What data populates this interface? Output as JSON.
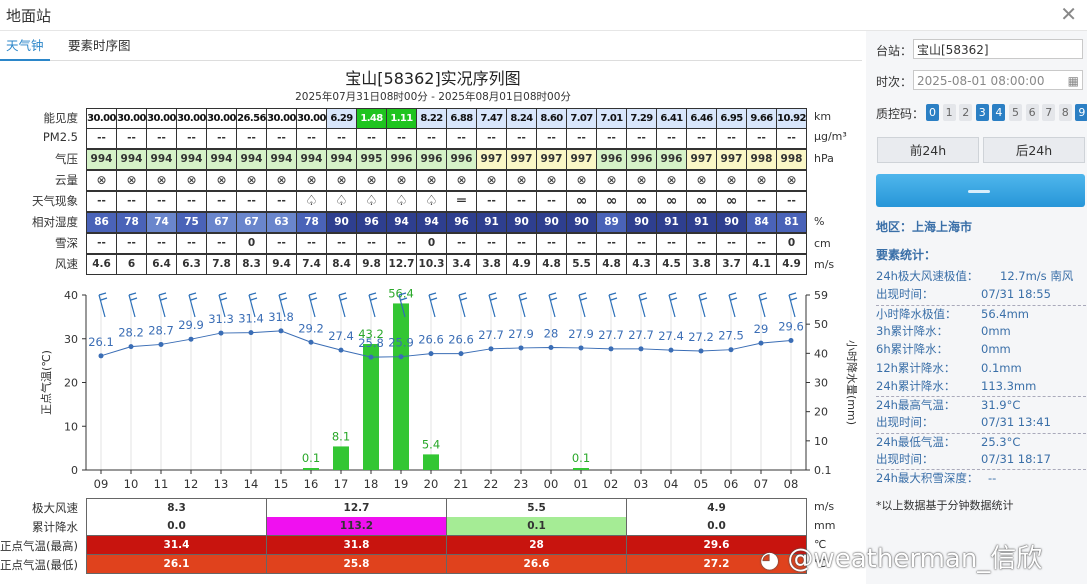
{
  "window": {
    "title": "地面站"
  },
  "tabs": [
    {
      "label": "天气钟"
    },
    {
      "label": "要素时序图"
    }
  ],
  "chart": {
    "title": "宝山[58362]实况序列图",
    "subtitle": "2025年07月31日08时00分 - 2025年08月01日08时00分"
  },
  "rows": {
    "visibility": {
      "label": "能见度",
      "unit": "km",
      "values": [
        "30.00",
        "30.00",
        "30.00",
        "30.00",
        "30.00",
        "26.56",
        "30.00",
        "30.00",
        "6.29",
        "1.48",
        "1.11",
        "8.22",
        "6.88",
        "7.47",
        "8.24",
        "8.60",
        "7.07",
        "7.01",
        "7.29",
        "6.41",
        "6.46",
        "6.95",
        "9.66",
        "10.92"
      ]
    },
    "pm25": {
      "label": "PM2.5",
      "unit": "μg/m³",
      "values": [
        "--",
        "--",
        "--",
        "--",
        "--",
        "--",
        "--",
        "--",
        "--",
        "--",
        "--",
        "--",
        "--",
        "--",
        "--",
        "--",
        "--",
        "--",
        "--",
        "--",
        "--",
        "--",
        "--",
        "--"
      ]
    },
    "pressure": {
      "label": "气压",
      "unit": "hPa",
      "values": [
        "994",
        "994",
        "994",
        "994",
        "994",
        "994",
        "994",
        "994",
        "994",
        "995",
        "996",
        "996",
        "996",
        "997",
        "997",
        "997",
        "997",
        "996",
        "996",
        "996",
        "997",
        "997",
        "998",
        "998"
      ]
    },
    "cloud": {
      "label": "云量",
      "symbol": "⊗",
      "count": 24
    },
    "weather": {
      "label": "天气现象",
      "codes": [
        "--",
        "--",
        "--",
        "--",
        "--",
        "--",
        "--",
        "rain",
        "rain",
        "rain",
        "rain",
        "rain",
        "fog",
        "--",
        "--",
        "--",
        "haze",
        "haze",
        "haze",
        "haze",
        "haze",
        "haze",
        "--",
        "--"
      ]
    },
    "humidity": {
      "label": "相对湿度",
      "unit": "%",
      "values": [
        "86",
        "78",
        "74",
        "75",
        "67",
        "67",
        "63",
        "78",
        "90",
        "96",
        "94",
        "94",
        "96",
        "91",
        "90",
        "90",
        "90",
        "89",
        "90",
        "91",
        "91",
        "90",
        "84",
        "81"
      ]
    },
    "snow": {
      "label": "雪深",
      "unit": "cm",
      "values": [
        "--",
        "--",
        "--",
        "--",
        "--",
        "0",
        "--",
        "--",
        "--",
        "--",
        "--",
        "0",
        "--",
        "--",
        "--",
        "--",
        "--",
        "--",
        "--",
        "--",
        "--",
        "--",
        "--",
        "0"
      ]
    },
    "wind": {
      "label": "风速",
      "unit": "m/s",
      "values": [
        "4.6",
        "6",
        "6.4",
        "6.3",
        "7.8",
        "8.3",
        "9.4",
        "7.4",
        "8.4",
        "9.8",
        "12.7",
        "10.3",
        "3.4",
        "3.8",
        "4.9",
        "4.8",
        "5.5",
        "4.8",
        "4.3",
        "4.5",
        "3.8",
        "3.7",
        "4.1",
        "4.9"
      ]
    }
  },
  "chart_data": {
    "type": "bar+line",
    "x": [
      "09",
      "10",
      "11",
      "12",
      "13",
      "14",
      "15",
      "16",
      "17",
      "18",
      "19",
      "20",
      "21",
      "22",
      "23",
      "00",
      "01",
      "02",
      "03",
      "04",
      "05",
      "06",
      "07",
      "08"
    ],
    "ylabel_left": "正点气温(℃)",
    "ylabel_right": "小时降水量(mm)",
    "ylim_left": [
      0,
      40
    ],
    "left_ticks": [
      0,
      10,
      20,
      30,
      40
    ],
    "right_ticks": [
      "59",
      "50",
      "40",
      "30",
      "20",
      "10",
      "0.1"
    ],
    "temperature": [
      26.1,
      28.2,
      28.7,
      29.9,
      31.3,
      31.4,
      31.8,
      29.2,
      27.4,
      25.8,
      25.9,
      26.6,
      26.6,
      27.7,
      27.9,
      28,
      27.9,
      27.7,
      27.7,
      27.4,
      27.2,
      27.5,
      29,
      29.6
    ],
    "precipitation": [
      null,
      null,
      null,
      null,
      null,
      null,
      null,
      0.1,
      8.1,
      43.2,
      56.4,
      5.4,
      null,
      null,
      null,
      null,
      0.1,
      null,
      null,
      null,
      null,
      null,
      null,
      null
    ]
  },
  "bottom": {
    "maxwind": {
      "label": "极大风速",
      "unit": "m/s",
      "values": [
        "8.3",
        "12.7",
        "5.5",
        "4.9"
      ]
    },
    "accprecip": {
      "label": "累计降水",
      "unit": "mm",
      "values": [
        "0.0",
        "113.2",
        "0.1",
        "0.0"
      ]
    },
    "tmax": {
      "label": "正点气温(最高)",
      "unit": "℃",
      "values": [
        "31.4",
        "31.8",
        "28",
        "29.6"
      ]
    },
    "tmin": {
      "label": "正点气温(最低)",
      "unit": "℃",
      "values": [
        "26.1",
        "25.8",
        "26.6",
        "27.2"
      ]
    }
  },
  "side": {
    "station_label": "台站：",
    "station_value": "宝山[58362]",
    "time_label": "时次：",
    "time_value": "2025-08-01 08:00:00",
    "qc_label": "质控码：",
    "qc_codes": [
      {
        "code": "0",
        "on": true
      },
      {
        "code": "1",
        "on": false
      },
      {
        "code": "2",
        "on": false
      },
      {
        "code": "3",
        "on": true
      },
      {
        "code": "4",
        "on": true
      },
      {
        "code": "5",
        "on": false
      },
      {
        "code": "6",
        "on": false
      },
      {
        "code": "7",
        "on": false
      },
      {
        "code": "8",
        "on": false
      },
      {
        "code": "9",
        "on": true
      }
    ],
    "prev_btn": "前24h",
    "next_btn": "后24h",
    "region": "地区：上海上海市",
    "stats_title": "要素统计：",
    "stats": [
      {
        "label": "24h极大风速极值：",
        "value": "12.7m/s 南风"
      },
      {
        "label": "出现时间：",
        "value": "07/31 18:55"
      },
      {
        "label": "小时降水极值：",
        "value": "56.4mm"
      },
      {
        "label": "3h累计降水：",
        "value": "0mm"
      },
      {
        "label": "6h累计降水：",
        "value": "0mm"
      },
      {
        "label": "12h累计降水：",
        "value": "0.1mm"
      },
      {
        "label": "24h累计降水：",
        "value": "113.3mm"
      },
      {
        "label": "24h最高气温：",
        "value": "31.9°C"
      },
      {
        "label": "出现时间：",
        "value": "07/31 13:41"
      },
      {
        "label": "24h最低气温：",
        "value": "25.3°C"
      },
      {
        "label": "出现时间：",
        "value": "07/31 18:17"
      },
      {
        "label": "24h最大积雪深度：",
        "value": "--"
      }
    ],
    "note": "*以上数据基于分钟数据统计"
  },
  "watermark": "@weatherman_信欣",
  "colors": {
    "vis_low": "#1fc41f",
    "vis_mid": "#d8e6fb",
    "vis_high": "#ffffff",
    "hum_dark": "#2e3f8f",
    "hum_mid": "#4a63b8",
    "hum_light": "#6a86cc",
    "pressure_green": "#d5f2c8",
    "pressure_yellow": "#fbf7c6",
    "temp_line": "#3a6db5",
    "precip_bar": "#33c633",
    "accent": "#2b86c9"
  }
}
